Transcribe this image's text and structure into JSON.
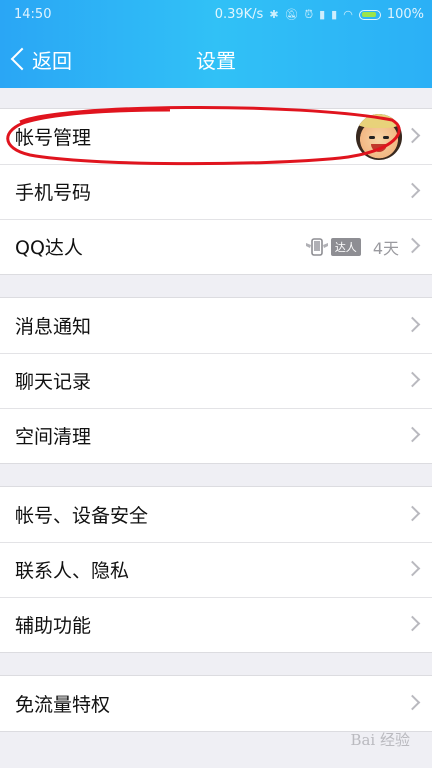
{
  "status_bar": {
    "time": "14:50",
    "net_speed": "0.39K/s",
    "battery_text": "100%"
  },
  "header": {
    "back_label": "返回",
    "title": "设置"
  },
  "groups": [
    {
      "items": [
        {
          "label": "帐号管理"
        },
        {
          "label": "手机号码"
        },
        {
          "label": "QQ达人",
          "badge": "达人",
          "days": "4天"
        }
      ]
    },
    {
      "items": [
        {
          "label": "消息通知"
        },
        {
          "label": "聊天记录"
        },
        {
          "label": "空间清理"
        }
      ]
    },
    {
      "items": [
        {
          "label": "帐号、设备安全"
        },
        {
          "label": "联系人、隐私"
        },
        {
          "label": "辅助功能"
        }
      ]
    },
    {
      "items": [
        {
          "label": "免流量特权"
        }
      ]
    }
  ],
  "watermark": "Bai 经验",
  "colors": {
    "header_bg": "#2bb0f6",
    "annotation_red": "#e0141e",
    "chevron": "#b9b9bf"
  },
  "icons": {
    "back": "chevron-left-icon",
    "row_arrow": "chevron-right-icon"
  }
}
